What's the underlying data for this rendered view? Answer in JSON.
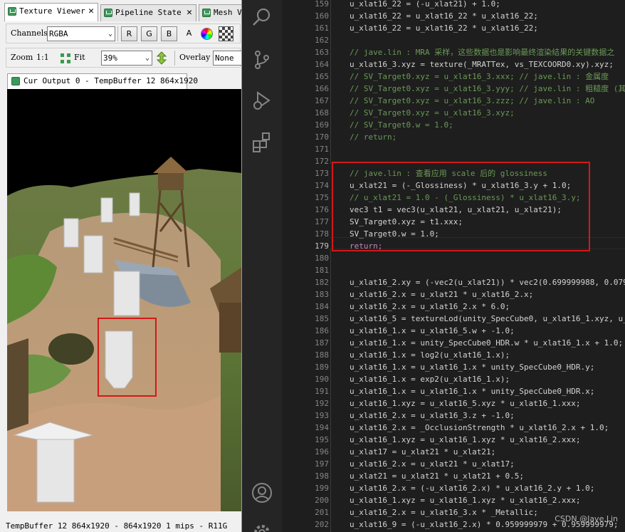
{
  "renderdoc": {
    "tabs": [
      {
        "label": "Texture Viewer",
        "close": "✕"
      },
      {
        "label": "Pipeline State",
        "close": "✕"
      },
      {
        "label": "Mesh V"
      }
    ],
    "channels_label": "Channels",
    "channels_value": "RGBA",
    "channel_buttons": [
      "R",
      "G",
      "B",
      "A"
    ],
    "zoom_label": "Zoom",
    "zoom_ratio": "1:1",
    "fit_label": "Fit",
    "zoom_value": "39%",
    "overlay_label": "Overlay",
    "overlay_value": "None",
    "output_tab": "Cur Output 0 - TempBuffer 12 864x1920",
    "status_text": "TempBuffer 12 864x1920 -  864x1920 1 mips - R11G"
  },
  "editor": {
    "watermark": "CSDN @Jave.Lin",
    "current_line": 179,
    "lines": [
      {
        "n": 159,
        "text": "u_xlat16_22 = (-u_xlat21) + 1.0;",
        "kind": "code"
      },
      {
        "n": 160,
        "text": "u_xlat16_22 = u_xlat16_22 * u_xlat16_22;",
        "kind": "code"
      },
      {
        "n": 161,
        "text": "u_xlat16_22 = u_xlat16_22 * u_xlat16_22;",
        "kind": "code"
      },
      {
        "n": 162,
        "text": "",
        "kind": "code"
      },
      {
        "n": 163,
        "text": "// jave.lin : MRA 采样，这些数据也是影响最终渲染结果的关键数据之",
        "kind": "comment"
      },
      {
        "n": 164,
        "text": "u_xlat16_3.xyz = texture(_MRATTex, vs_TEXCOORD0.xy).xyz;",
        "kind": "code"
      },
      {
        "n": 165,
        "text": "// SV_Target0.xyz = u_xlat16_3.xxx; // jave.lin : 金属度",
        "kind": "comment"
      },
      {
        "n": 166,
        "text": "// SV_Target0.xyz = u_xlat16_3.yyy; // jave.lin : 粗糙度 (其",
        "kind": "comment"
      },
      {
        "n": 167,
        "text": "// SV_Target0.xyz = u_xlat16_3.zzz; // jave.lin : AO",
        "kind": "comment"
      },
      {
        "n": 168,
        "text": "// SV_Target0.xyz = u_xlat16_3.xyz;",
        "kind": "comment"
      },
      {
        "n": 169,
        "text": "// SV_Target0.w = 1.0;",
        "kind": "comment"
      },
      {
        "n": 170,
        "text": "// return;",
        "kind": "comment"
      },
      {
        "n": 171,
        "text": "",
        "kind": "code"
      },
      {
        "n": 172,
        "text": "",
        "kind": "code"
      },
      {
        "n": 173,
        "text": "// jave.lin : 查看应用 scale 后的 glossiness",
        "kind": "comment"
      },
      {
        "n": 174,
        "text": "u_xlat21 = (-_Glossiness) * u_xlat16_3.y + 1.0;",
        "kind": "code"
      },
      {
        "n": 175,
        "text": "// u_xlat21 = 1.0 - (_Glossiness) * u_xlat16_3.y;",
        "kind": "comment"
      },
      {
        "n": 176,
        "text": "vec3 t1 = vec3(u_xlat21, u_xlat21, u_xlat21);",
        "kind": "code"
      },
      {
        "n": 177,
        "text": "SV_Target0.xyz = t1.xxx;",
        "kind": "code"
      },
      {
        "n": 178,
        "text": "SV_Target0.w = 1.0;",
        "kind": "code"
      },
      {
        "n": 179,
        "text": "return;",
        "kind": "control"
      },
      {
        "n": 180,
        "text": "",
        "kind": "code"
      },
      {
        "n": 181,
        "text": "",
        "kind": "code"
      },
      {
        "n": 182,
        "text": "u_xlat16_2.xy = (-vec2(u_xlat21)) * vec2(0.699999988, 0.079",
        "kind": "code"
      },
      {
        "n": 183,
        "text": "u_xlat16_2.x = u_xlat21 * u_xlat16_2.x;",
        "kind": "code"
      },
      {
        "n": 184,
        "text": "u_xlat16_2.x = u_xlat16_2.x * 6.0;",
        "kind": "code"
      },
      {
        "n": 185,
        "text": "u_xlat16_5 = textureLod(unity_SpecCube0, u_xlat16_1.xyz, u_",
        "kind": "code"
      },
      {
        "n": 186,
        "text": "u_xlat16_1.x = u_xlat16_5.w + -1.0;",
        "kind": "code"
      },
      {
        "n": 187,
        "text": "u_xlat16_1.x = unity_SpecCube0_HDR.w * u_xlat16_1.x + 1.0;",
        "kind": "code"
      },
      {
        "n": 188,
        "text": "u_xlat16_1.x = log2(u_xlat16_1.x);",
        "kind": "code"
      },
      {
        "n": 189,
        "text": "u_xlat16_1.x = u_xlat16_1.x * unity_SpecCube0_HDR.y;",
        "kind": "code"
      },
      {
        "n": 190,
        "text": "u_xlat16_1.x = exp2(u_xlat16_1.x);",
        "kind": "code"
      },
      {
        "n": 191,
        "text": "u_xlat16_1.x = u_xlat16_1.x * unity_SpecCube0_HDR.x;",
        "kind": "code"
      },
      {
        "n": 192,
        "text": "u_xlat16_1.xyz = u_xlat16_5.xyz * u_xlat16_1.xxx;",
        "kind": "code"
      },
      {
        "n": 193,
        "text": "u_xlat16_2.x = u_xlat16_3.z + -1.0;",
        "kind": "code"
      },
      {
        "n": 194,
        "text": "u_xlat16_2.x = _OcclusionStrength * u_xlat16_2.x + 1.0;",
        "kind": "code"
      },
      {
        "n": 195,
        "text": "u_xlat16_1.xyz = u_xlat16_1.xyz * u_xlat16_2.xxx;",
        "kind": "code"
      },
      {
        "n": 196,
        "text": "u_xlat17 = u_xlat21 * u_xlat21;",
        "kind": "code"
      },
      {
        "n": 197,
        "text": "u_xlat16_2.x = u_xlat21 * u_xlat17;",
        "kind": "code"
      },
      {
        "n": 198,
        "text": "u_xlat21 = u_xlat21 * u_xlat21 + 0.5;",
        "kind": "code"
      },
      {
        "n": 199,
        "text": "u_xlat16_2.x = (-u_xlat16_2.x) * u_xlat16_2.y + 1.0;",
        "kind": "code"
      },
      {
        "n": 200,
        "text": "u_xlat16_1.xyz = u_xlat16_1.xyz * u_xlat16_2.xxx;",
        "kind": "code"
      },
      {
        "n": 201,
        "text": "u_xlat16_2.x = u_xlat16_3.x * _Metallic;",
        "kind": "code"
      },
      {
        "n": 202,
        "text": "u_xlat16_9 = (-u_xlat16_2.x) * 0.959999979 + 0.959999979;",
        "kind": "code"
      },
      {
        "n": 203,
        "text": "u_xlat16_16 = (-u_xlat16_9) + 1.0;",
        "kind": "code"
      }
    ]
  }
}
